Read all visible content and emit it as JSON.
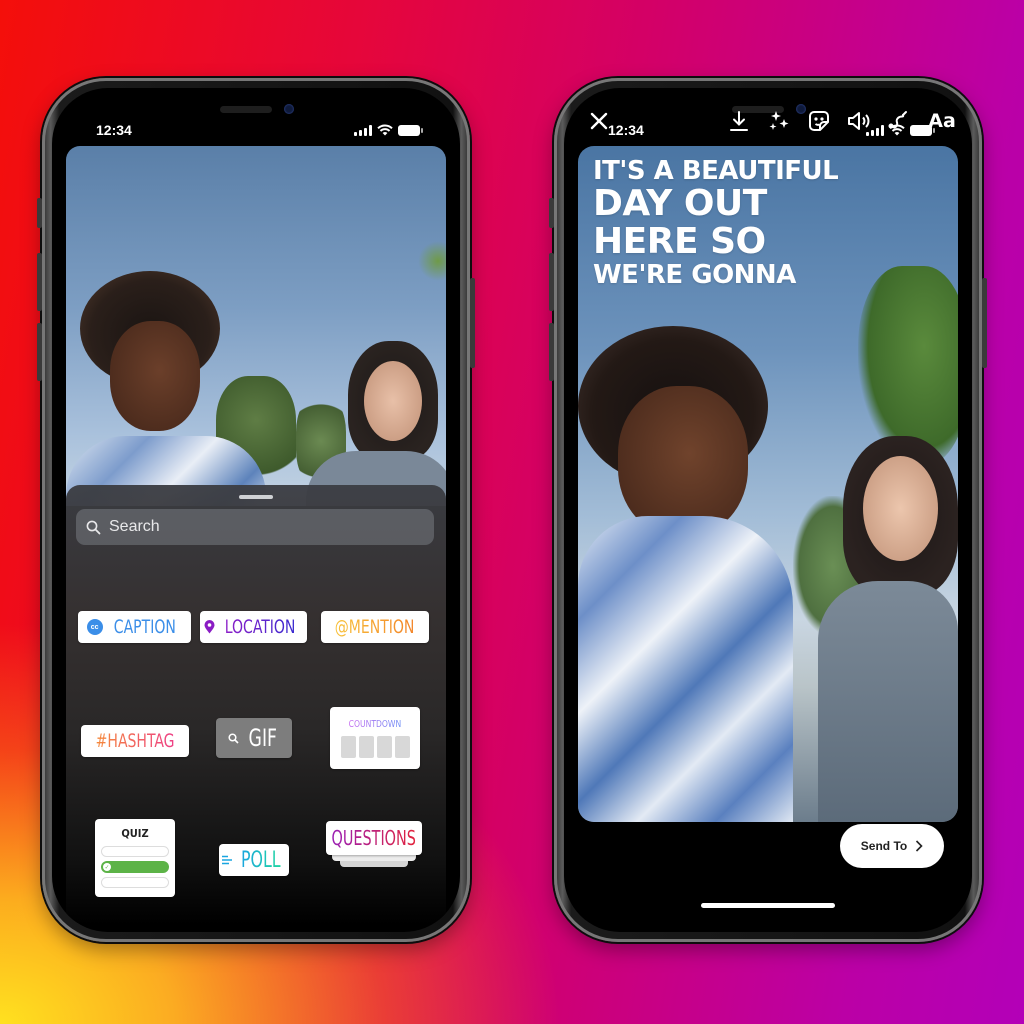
{
  "background": {
    "gradient_colors": [
      "#ffe11f",
      "#f40f0a",
      "#d30068",
      "#b300b8"
    ]
  },
  "phones": {
    "left": {
      "status_bar": {
        "time": "12:34",
        "icons": [
          "signal-icon",
          "wifi-icon",
          "battery-icon"
        ]
      },
      "sticker_tray": {
        "search_placeholder": "Search",
        "stickers": [
          {
            "label": "CAPTION",
            "icon": "cc-icon",
            "color": "#3b8ee8"
          },
          {
            "label": "LOCATION",
            "icon": "location-pin-icon",
            "color": "#7a1cc4"
          },
          {
            "label": "@MENTION",
            "icon": "at-icon",
            "color": "#f5a623"
          },
          {
            "label": "#HASHTAG",
            "icon": "hash-icon",
            "color": "#f0613a"
          },
          {
            "label": "GIF",
            "icon": "search-icon",
            "color": "#ffffff"
          },
          {
            "label": "COUNTDOWN",
            "icon": "",
            "color": "#a66cf0"
          },
          {
            "label": "QUIZ",
            "icon": "check-icon",
            "color": "#222222"
          },
          {
            "label": "POLL",
            "icon": "poll-lines-icon",
            "color": "#1aa6e0"
          },
          {
            "label": "QUESTIONS",
            "icon": "",
            "color": "#c1157b"
          }
        ]
      }
    },
    "right": {
      "status_bar": {
        "time": "12:34",
        "icons": [
          "signal-icon",
          "wifi-icon",
          "battery-icon"
        ]
      },
      "toolbar": {
        "close": "close-icon",
        "actions": [
          "download-icon",
          "effects-sparkle-icon",
          "sticker-icon",
          "sound-icon",
          "draw-icon"
        ],
        "text_label": "Aa"
      },
      "caption_lines": [
        "IT'S A BEAUTIFUL",
        "DAY OUT",
        "HERE SO",
        "WE'RE GONNA"
      ],
      "send_to_label": "Send To"
    }
  }
}
